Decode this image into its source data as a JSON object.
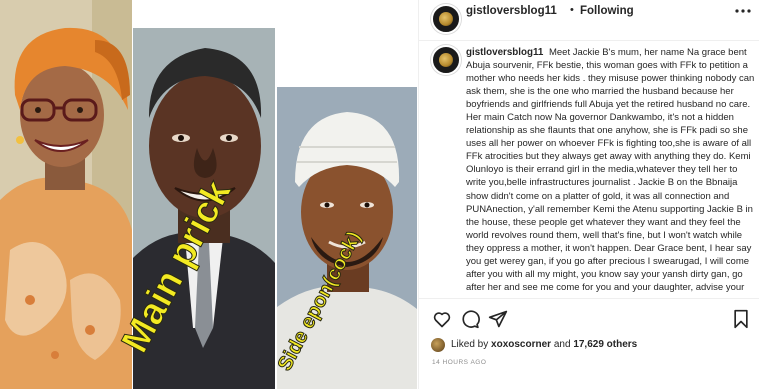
{
  "media": {
    "overlay_main": "Main prick",
    "overlay_side": "Side epon(cock)"
  },
  "post": {
    "username": "gistloversblog11",
    "separator": "•",
    "follow_status": "Following",
    "more_icon": "more-horizontal-icon",
    "caption_text": "Meet Jackie B's mum, her name Na grace bent Abuja sourvenir, FFk bestie, this woman goes with FFk to petition a mother who needs her kids . they misuse power thinking nobody can ask them, she is the one who married the husband because her boyfriends and girlfriends full Abuja yet the retired husband no care. Her main Catch now Na governor Dankwambo, it's not a hidden relationship as she flaunts that one anyhow, she is FFk padi so she uses all her power on whoever FFk is fighting too,she is aware of all FFk atrocities but they always get away with anything they do. Kemi Olunloyo is their errand girl in the media,whatever they tell her to write you,belle infrastructures journalist . Jackie B on the Bbnaija show didn't come on a platter of gold, it was all connection and PUNAnection, y'all remember Kemi the Atenu supporting Jackie B in the house, these people get whatever they want and they feel the world revolves round them, well that's fine, but I won't watch while they oppress a mother, it won't happen. Dear Grace bent, I hear say you get werey gan, if you go after precious I swearugad, I will come after you with all my might, you know say your yansh dirty gan, go after her and see me come for you and your daughter, advise your olorihunku bestie FFk to",
    "likes_prefix": "Liked by",
    "likes_user": "xoxoscorner",
    "likes_and": "and",
    "likes_count": "17,629 others",
    "time_ago": "14 HOURS AGO"
  },
  "colors": {
    "overlay_yellow": "#f3ea22",
    "text_primary": "#262626",
    "text_secondary": "#8e8e8e",
    "divider": "#efefef"
  }
}
